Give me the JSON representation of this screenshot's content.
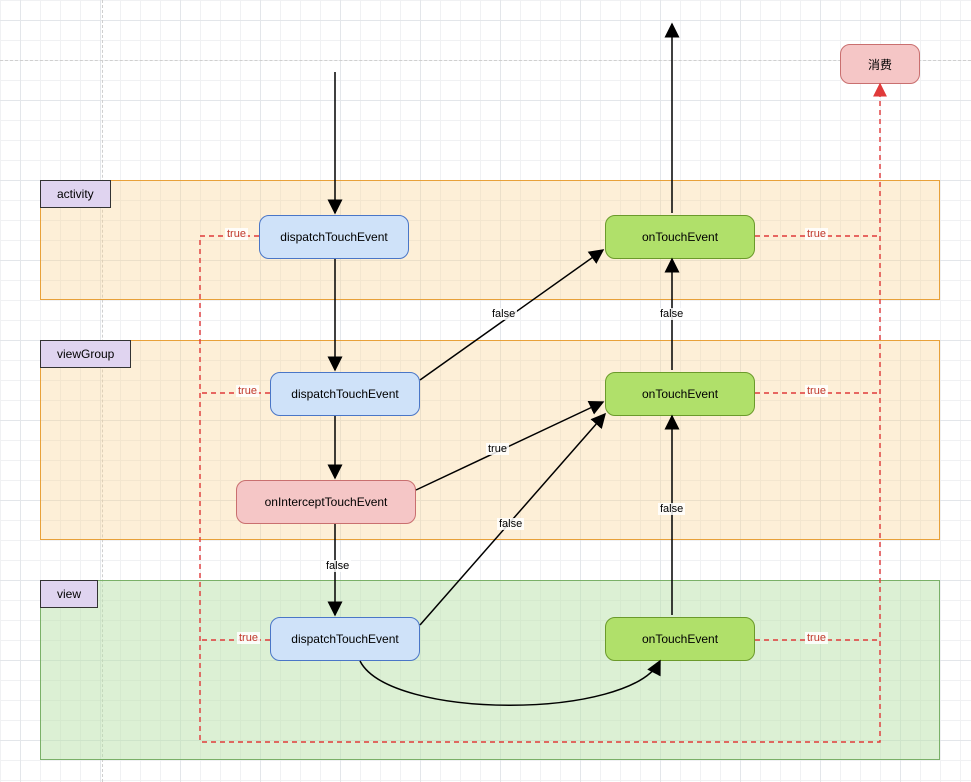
{
  "lanes": {
    "activity": "activity",
    "viewgroup": "viewGroup",
    "view": "view"
  },
  "nodes": {
    "act_dispatch": "dispatchTouchEvent",
    "vg_dispatch": "dispatchTouchEvent",
    "vg_intercept": "onInterceptTouchEvent",
    "view_dispatch": "dispatchTouchEvent",
    "act_ontouch": "onTouchEvent",
    "vg_ontouch": "onTouchEvent",
    "view_ontouch": "onTouchEvent",
    "consume": "消费"
  },
  "edges": {
    "e01": "true",
    "e02": "true",
    "e03": "true",
    "e04": "true",
    "e05": "true",
    "e06": "true",
    "e07": "true",
    "e08": "false",
    "e09": "false",
    "e10": "false",
    "e11": "false",
    "e12": "false"
  }
}
